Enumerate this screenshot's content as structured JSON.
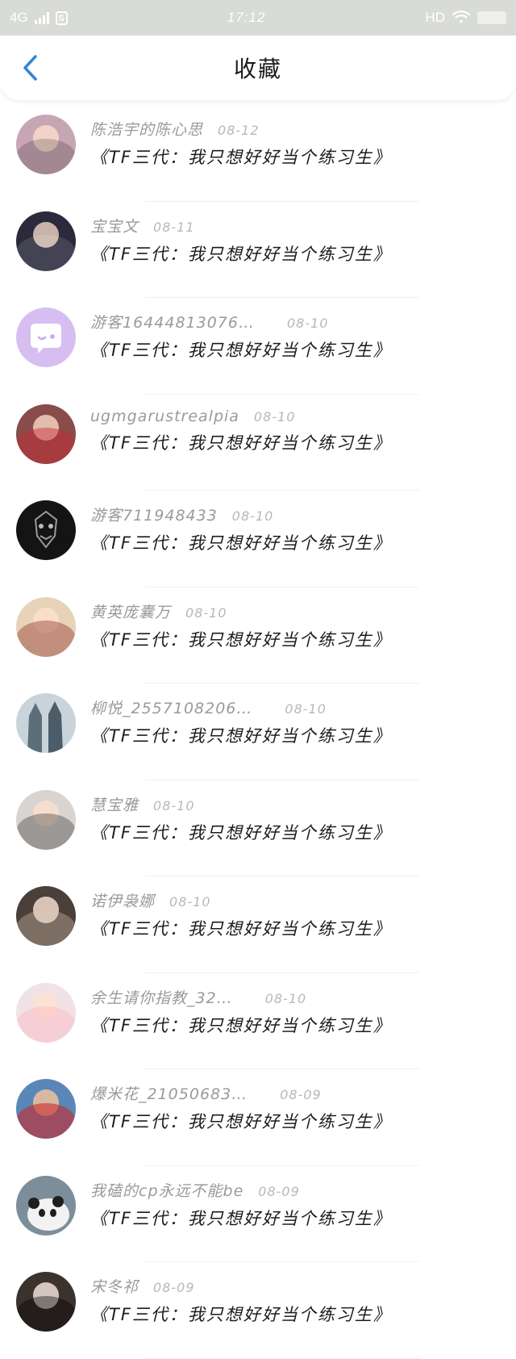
{
  "status_bar": {
    "network": "4G",
    "time": "17:12",
    "hd": "HD"
  },
  "header": {
    "title": "收藏",
    "back_icon": "chevron-left-icon"
  },
  "colors": {
    "accent": "#2f86dc",
    "status_bar_bg": "#d9dbd6"
  },
  "items": [
    {
      "username": "陈浩宇的陈心思",
      "date": "08-12",
      "content": "《TF三代：我只想好好当个练习生》",
      "avatar_color": "#c7a6b4"
    },
    {
      "username": "宝宝文",
      "date": "08-11",
      "content": "《TF三代：我只想好好当个练习生》",
      "avatar_color": "#2b2a3d"
    },
    {
      "username": "游客16444813076…",
      "date": "08-10",
      "content": "《TF三代：我只想好好当个练习生》",
      "avatar_color": "#d6bff0"
    },
    {
      "username": "ugmgarustrealpia",
      "date": "08-10",
      "content": "《TF三代：我只想好好当个练习生》",
      "avatar_color": "#8a4b4b"
    },
    {
      "username": "游客711948433",
      "date": "08-10",
      "content": "《TF三代：我只想好好当个练习生》",
      "avatar_color": "#141414"
    },
    {
      "username": "黄英庞囊万",
      "date": "08-10",
      "content": "《TF三代：我只想好好当个练习生》",
      "avatar_color": "#e6d3b8"
    },
    {
      "username": "柳悦_2557108206…",
      "date": "08-10",
      "content": "《TF三代：我只想好好当个练习生》",
      "avatar_color": "#8fa0ad"
    },
    {
      "username": "慧宝雅",
      "date": "08-10",
      "content": "《TF三代：我只想好好当个练习生》",
      "avatar_color": "#d9d4d0"
    },
    {
      "username": "诺伊袅娜",
      "date": "08-10",
      "content": "《TF三代：我只想好好当个练习生》",
      "avatar_color": "#4a3f39"
    },
    {
      "username": "余生请你指教_32…",
      "date": "08-10",
      "content": "《TF三代：我只想好好当个练习生》",
      "avatar_color": "#f1e2e6"
    },
    {
      "username": "爆米花_21050683…",
      "date": "08-09",
      "content": "《TF三代：我只想好好当个练习生》",
      "avatar_color": "#5b86b8"
    },
    {
      "username": "我磕的cp永远不能be",
      "date": "08-09",
      "content": "《TF三代：我只想好好当个练习生》",
      "avatar_color": "#7c8e99"
    },
    {
      "username": "宋冬祁",
      "date": "08-09",
      "content": "《TF三代：我只想好好当个练习生》",
      "avatar_color": "#3b322e"
    }
  ]
}
